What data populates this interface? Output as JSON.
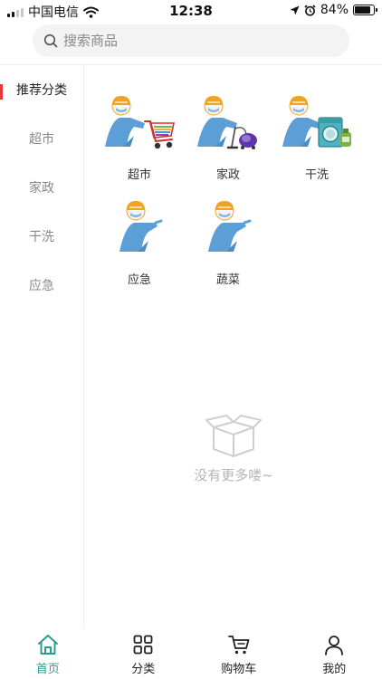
{
  "status_bar": {
    "carrier": "中国电信",
    "time": "12:38",
    "battery": "84%",
    "battery_level": 0.84
  },
  "search": {
    "placeholder": "搜索商品"
  },
  "sidebar": {
    "items": [
      {
        "label": "推荐分类",
        "active": true
      },
      {
        "label": "超市",
        "active": false
      },
      {
        "label": "家政",
        "active": false
      },
      {
        "label": "干洗",
        "active": false
      },
      {
        "label": "应急",
        "active": false
      }
    ]
  },
  "categories": [
    {
      "label": "超市",
      "icon": "delivery-person-cart-icon"
    },
    {
      "label": "家政",
      "icon": "delivery-person-vacuum-icon"
    },
    {
      "label": "干洗",
      "icon": "delivery-person-washer-icon"
    },
    {
      "label": "应急",
      "icon": "delivery-person-icon"
    },
    {
      "label": "蔬菜",
      "icon": "delivery-person-icon"
    }
  ],
  "empty_state": {
    "text": "没有更多喽~",
    "icon": "empty-box-icon"
  },
  "tab_bar": {
    "tabs": [
      {
        "label": "首页",
        "icon": "home-icon",
        "active": true
      },
      {
        "label": "分类",
        "icon": "grid-icon",
        "active": false
      },
      {
        "label": "购物车",
        "icon": "cart-icon",
        "active": false
      },
      {
        "label": "我的",
        "icon": "user-icon",
        "active": false
      }
    ]
  },
  "colors": {
    "accent": "#2a9d8f",
    "sidebar_indicator": "#e53935",
    "figure_blue": "#5b9fd6",
    "helmet_orange": "#f0a320"
  }
}
